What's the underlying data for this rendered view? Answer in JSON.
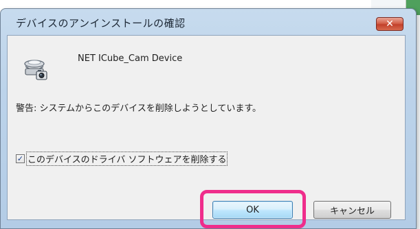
{
  "dialog": {
    "title": "デバイスのアンインストールの確認",
    "close_symbol": "✕",
    "device_name": "NET ICube_Cam Device",
    "warning": "警告: システムからこのデバイスを削除しようとしています。",
    "checkbox": {
      "checked": true,
      "label": "このデバイスのドライバ ソフトウェアを削除する"
    },
    "buttons": {
      "ok": "OK",
      "cancel": "キャンセル"
    }
  },
  "icons": {
    "device": "webcam-icon",
    "close": "close-icon",
    "check": "checkmark-icon"
  },
  "colors": {
    "highlight": "#ef2d8b",
    "close_button": "#c2402a"
  }
}
